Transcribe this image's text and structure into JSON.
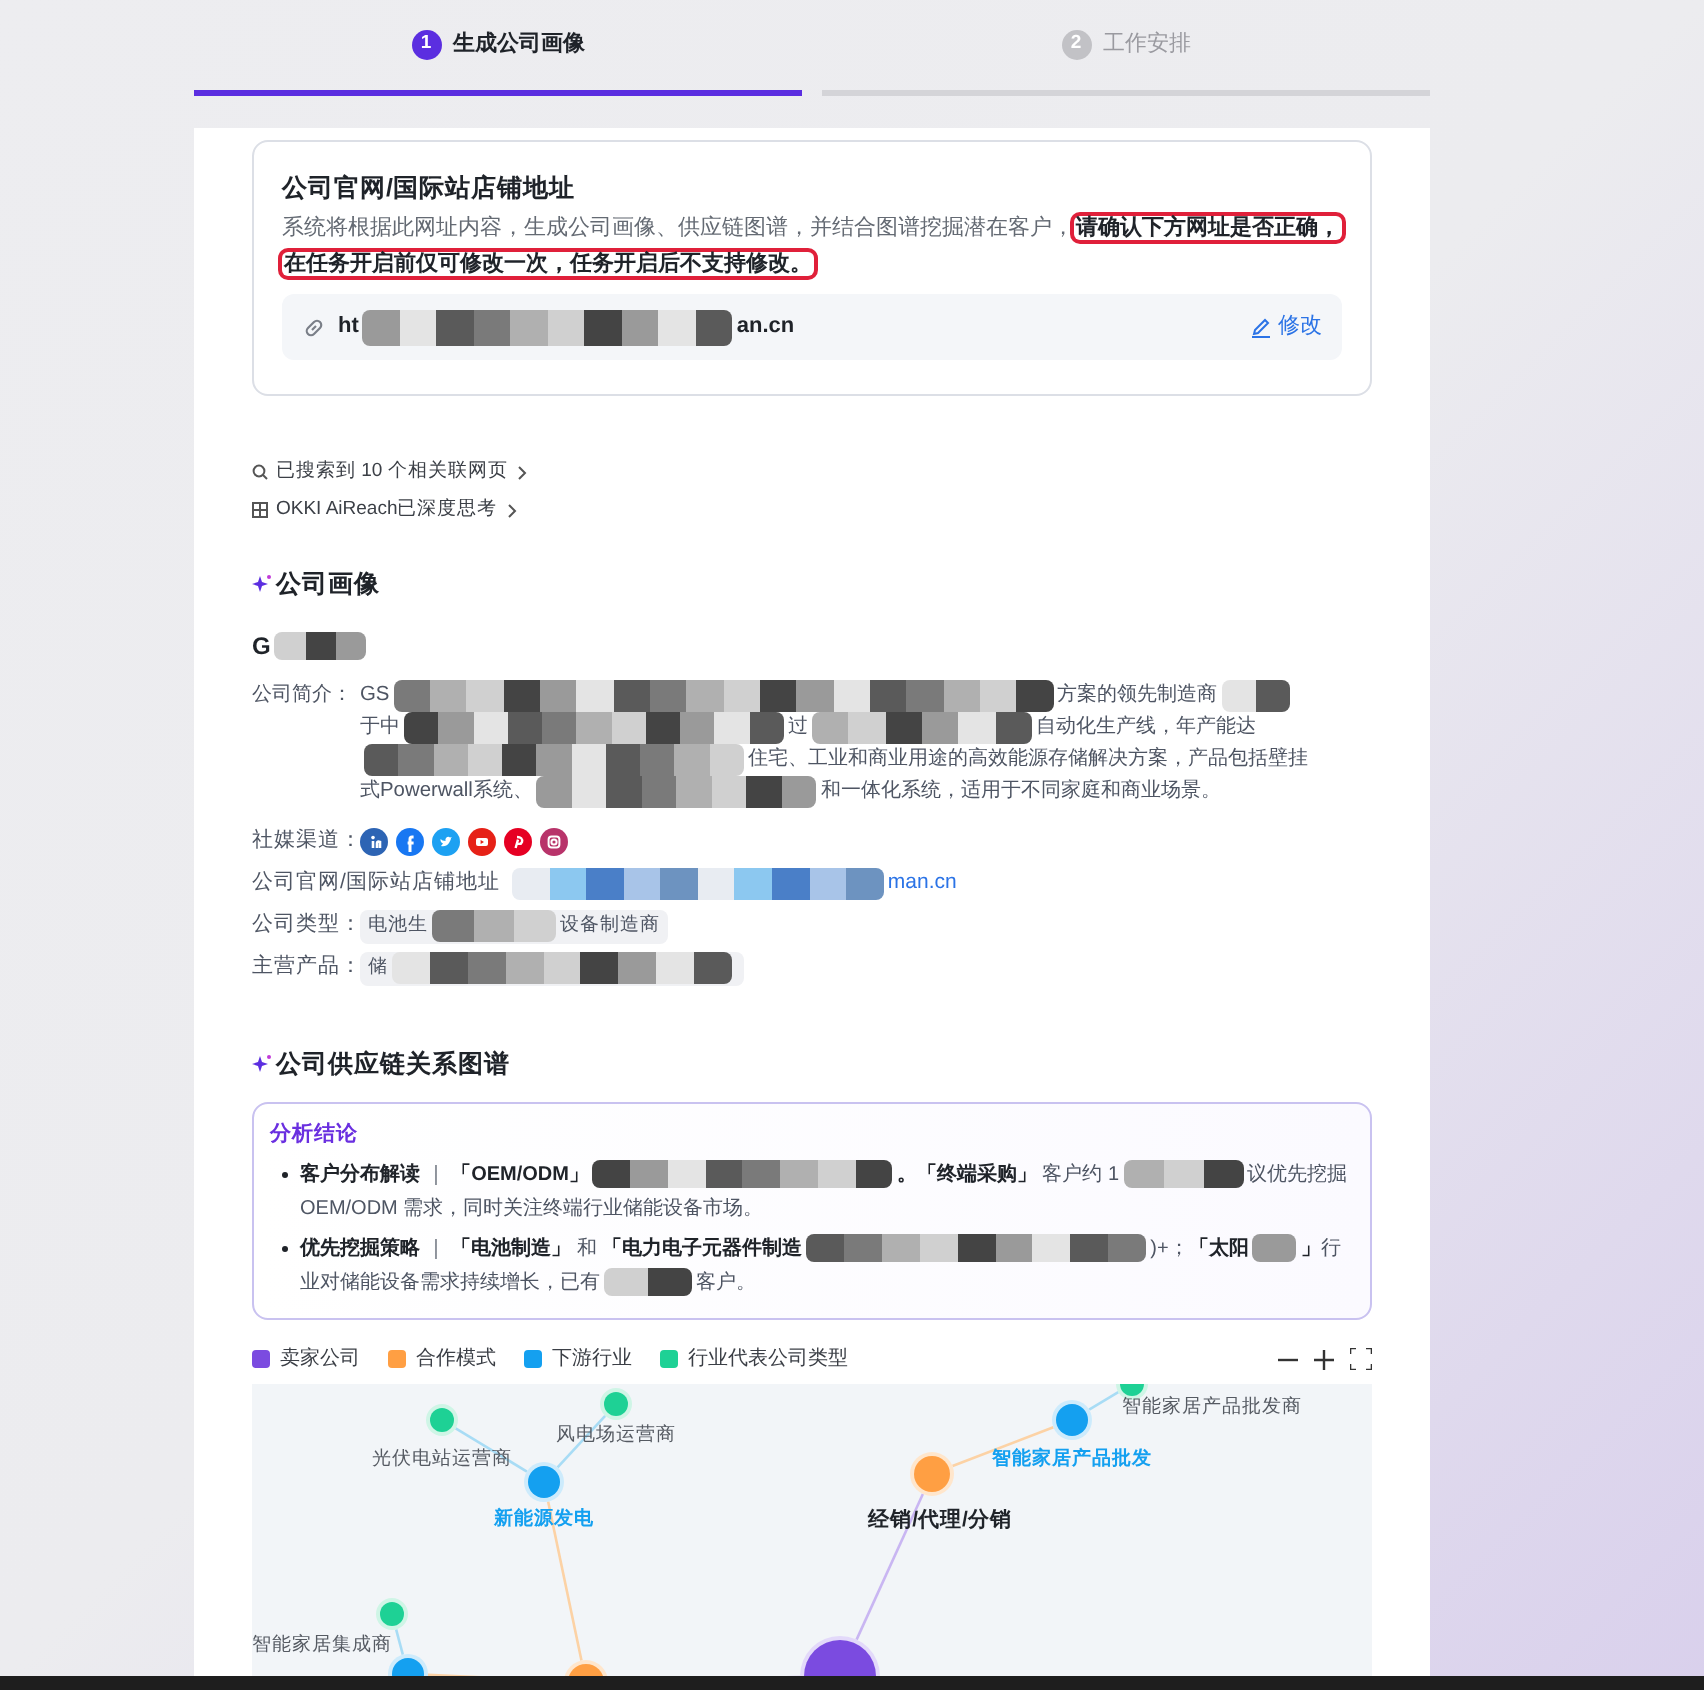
{
  "steps": [
    {
      "number": "1",
      "label": "生成公司画像",
      "selected": true
    },
    {
      "number": "2",
      "label": "工作安排",
      "selected": false
    }
  ],
  "url_card": {
    "title": "公司官网/国际站店铺地址",
    "description": [
      {
        "kind": "text",
        "text": "系统将根据此网址内容，生成公司画像、供应链图谱，并结合图谱挖掘潜在客户，"
      },
      {
        "kind": "highlight",
        "text": "请确认下方网址是否正确，在任务开启前仅可修改一次，任务开启后不支持修改。"
      }
    ],
    "url": [
      {
        "kind": "text",
        "text": "ht"
      },
      {
        "kind": "redacted"
      },
      {
        "kind": "text",
        "text": "an.cn"
      }
    ],
    "edit_link": "修改"
  },
  "progress": [
    {
      "kind": "search",
      "text": "已搜索到 10 个相关联网页"
    },
    {
      "kind": "thinking",
      "text": "OKKI AiReach已深度思考"
    }
  ],
  "profile": {
    "title": "公司画像",
    "company_name": [
      {
        "kind": "text",
        "text": "G"
      },
      {
        "kind": "redacted"
      }
    ],
    "intro_label": "公司简介：",
    "intro_lines": [
      [
        {
          "kind": "text",
          "text": "GS"
        },
        {
          "kind": "redacted"
        },
        {
          "kind": "text",
          "text": "方案的领先制造商"
        },
        {
          "kind": "redacted"
        }
      ],
      [
        {
          "kind": "text",
          "text": "于中"
        },
        {
          "kind": "redacted"
        },
        {
          "kind": "text",
          "text": "过"
        },
        {
          "kind": "redacted"
        },
        {
          "kind": "text",
          "text": "自动化生产线，年产能达"
        }
      ],
      [
        {
          "kind": "redacted"
        },
        {
          "kind": "text",
          "text": "住宅、工业和商业用途的高效能源存储解决方案，产品包括壁挂"
        }
      ],
      [
        {
          "kind": "text",
          "text": "式Powerwall系统、"
        },
        {
          "kind": "redacted"
        },
        {
          "kind": "text",
          "text": "和一体化系统，适用于不同家庭和商业场景。"
        }
      ]
    ],
    "social_label": "社媒渠道：",
    "website_label": "公司官网/国际站店铺地址",
    "website": [
      {
        "kind": "redacted"
      },
      {
        "kind": "text",
        "text": "man.cn"
      }
    ],
    "type_label": "公司类型：",
    "type_tag": [
      {
        "kind": "text",
        "text": "电池生"
      },
      {
        "kind": "redacted"
      },
      {
        "kind": "text",
        "text": "设备制造商"
      }
    ],
    "products_label": "主营产品：",
    "products_tag": [
      {
        "kind": "text",
        "text": "储"
      },
      {
        "kind": "redacted"
      }
    ]
  },
  "supply_chain": {
    "title": "公司供应链关系图谱",
    "analysis_title": "分析结论",
    "bullets": [
      [
        {
          "kind": "bold",
          "text": "客户分布解读"
        },
        {
          "kind": "text",
          "text": " ｜ "
        },
        {
          "kind": "bold",
          "text": "「OEM/ODM」"
        },
        {
          "kind": "redacted"
        },
        {
          "kind": "bold",
          "text": "。「终端采购」"
        },
        {
          "kind": "text",
          "text": " 客户约 1"
        },
        {
          "kind": "redacted"
        },
        {
          "kind": "text",
          "text": "议优先挖掘 OEM/ODM 需求，同时关注终端行业储能设备市场。"
        }
      ],
      [
        {
          "kind": "bold",
          "text": "优先挖掘策略"
        },
        {
          "kind": "text",
          "text": " ｜ "
        },
        {
          "kind": "bold",
          "text": "「电池制造」"
        },
        {
          "kind": "text",
          "text": " 和 "
        },
        {
          "kind": "bold",
          "text": "「电力电子元器件制造"
        },
        {
          "kind": "redacted"
        },
        {
          "kind": "text",
          "text": ")+；"
        },
        {
          "kind": "bold",
          "text": "「太阳"
        },
        {
          "kind": "redacted"
        },
        {
          "kind": "bold",
          "text": "」"
        },
        {
          "kind": "text",
          "text": "行业对储能设备需求持续增长，已有"
        },
        {
          "kind": "redacted"
        },
        {
          "kind": "text",
          "text": "客户。"
        }
      ]
    ],
    "legend": [
      {
        "label": "卖家公司",
        "color": "#7b4be0"
      },
      {
        "label": "合作模式",
        "color": "#ff9f43"
      },
      {
        "label": "下游行业",
        "color": "#14a0f0"
      },
      {
        "label": "行业代表公司类型",
        "color": "#1ed195"
      }
    ],
    "graph": {
      "nodes": [
        {
          "kind": "company_type",
          "label": "光伏电站运营商"
        },
        {
          "kind": "company_type",
          "label": "风电场运营商"
        },
        {
          "kind": "industry",
          "label": "新能源发电"
        },
        {
          "kind": "mode",
          "label": "经销/代理/分销"
        },
        {
          "kind": "industry",
          "label": "智能家居产品批发"
        },
        {
          "kind": "company_type",
          "label": "智能家居产品批发商"
        },
        {
          "kind": "company_type",
          "label": "智能家居集成商"
        },
        {
          "kind": "industry"
        },
        {
          "kind": "mode"
        },
        {
          "kind": "seller"
        }
      ]
    }
  }
}
